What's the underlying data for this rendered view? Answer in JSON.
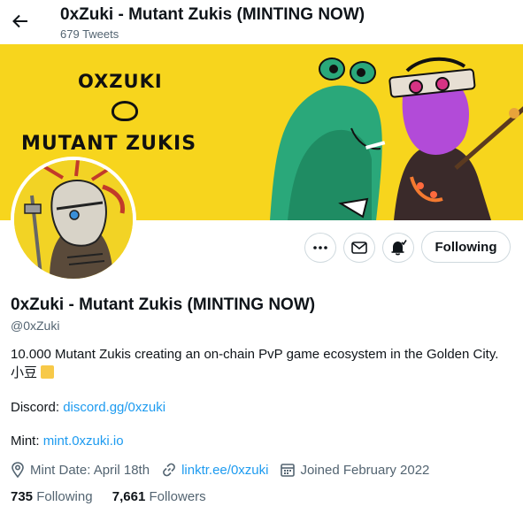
{
  "header": {
    "title": "0xZuki - Mutant Zukis (MINTING NOW)",
    "tweet_count": "679 Tweets"
  },
  "banner": {
    "text_top": "OXZUKI",
    "text_bottom": "MUTANT ZUKIS"
  },
  "actions": {
    "more_icon": "more-icon",
    "message_icon": "mail-icon",
    "notify_icon": "bell-icon",
    "follow_label": "Following"
  },
  "profile": {
    "name": "0xZuki - Mutant Zukis (MINTING NOW)",
    "handle": "@0xZuki",
    "bio_line1": "10.000 Mutant Zukis creating an on-chain PvP game ecosystem in the Golden City.",
    "bio_line2": "小豆",
    "discord_label": "Discord: ",
    "discord_link": "discord.gg/0xzuki",
    "mint_label": "Mint: ",
    "mint_link": "mint.0xzuki.io"
  },
  "meta": {
    "mint_date": "Mint Date: April 18th",
    "website": "linktr.ee/0xzuki",
    "joined": "Joined February 2022"
  },
  "stats": {
    "following_count": "735",
    "following_label": "Following",
    "followers_count": "7,661",
    "followers_label": "Followers"
  },
  "colors": {
    "accent": "#1d9bf0",
    "banner": "#f7d51d",
    "muted": "#536471"
  }
}
